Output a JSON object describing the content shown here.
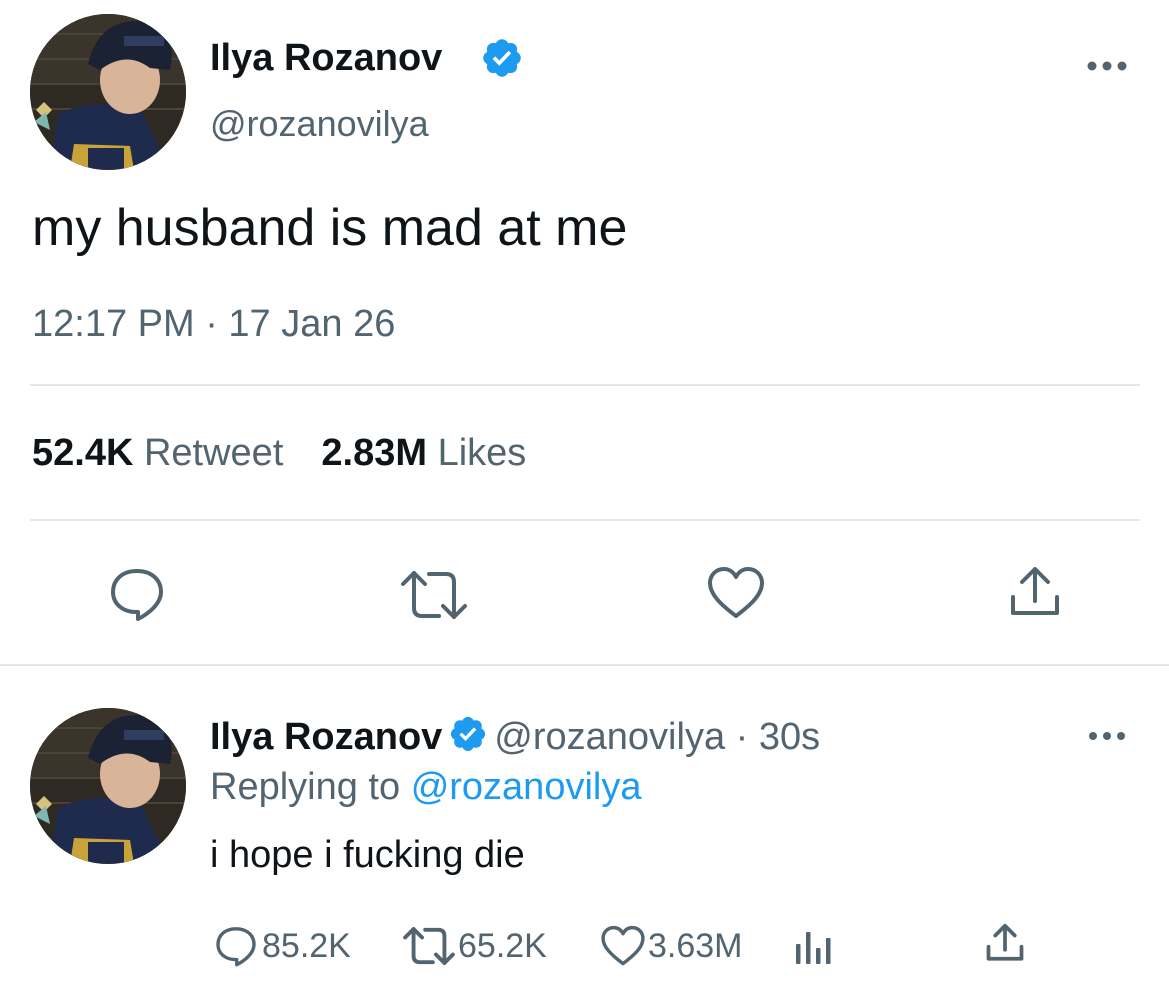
{
  "main_tweet": {
    "author_name": "Ilya Rozanov",
    "author_handle": "@rozanovilya",
    "verified": true,
    "text": "my husband is mad at me",
    "timestamp": "12:17 PM · 17 Jan 26",
    "retweet_count": "52.4K",
    "retweet_label": "Retweet",
    "likes_count": "2.83M",
    "likes_label": "Likes",
    "actions": [
      {
        "icon": "reply-icon"
      },
      {
        "icon": "retweet-icon"
      },
      {
        "icon": "like-icon"
      },
      {
        "icon": "share-icon"
      }
    ],
    "more_icon": "more-options-icon"
  },
  "reply_tweet": {
    "author_name": "Ilya Rozanov",
    "author_handle": "@rozanovilya",
    "separator": "·",
    "age": "30s",
    "verified": true,
    "replying_prefix": "Replying to",
    "replying_to": "@rozanovilya",
    "text": "i hope i fucking die",
    "reply_count": "85.2K",
    "retweet_count": "65.2K",
    "like_count": "3.63M",
    "more_icon": "more-options-icon"
  },
  "colors": {
    "text_primary": "#0f1419",
    "text_secondary": "#536471",
    "accent_blue": "#1d9bf0",
    "divider": "#e4e7ea"
  }
}
